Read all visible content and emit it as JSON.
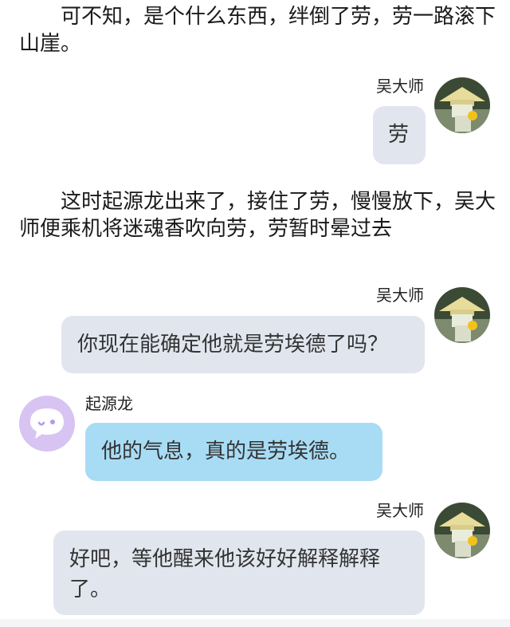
{
  "narration": {
    "p1": "可不知，是个什么东西，绊倒了劳，劳一路滚下山崖。",
    "p2": "这时起源龙出来了，接住了劳，慢慢放下，吴大师便乘机将迷魂香吹向劳，劳暂时晕过去"
  },
  "messages": [
    {
      "speaker": "吴大师",
      "text": "劳",
      "avatar": "old-master-avatar"
    },
    {
      "speaker": "吴大师",
      "text": "你现在能确定他就是劳埃德了吗？",
      "avatar": "old-master-avatar"
    },
    {
      "speaker": "起源龙",
      "text": "他的气息，真的是劳埃德。",
      "avatar": "purple-chat-avatar"
    },
    {
      "speaker": "吴大师",
      "text": "好吧，等他醒来他该好好解释解释了。",
      "avatar": "old-master-avatar"
    }
  ],
  "colors": {
    "right_bubble": "#e1e6ee",
    "left_bubble": "#a8dcf5",
    "avatar_purple": "#d7c4f2"
  }
}
